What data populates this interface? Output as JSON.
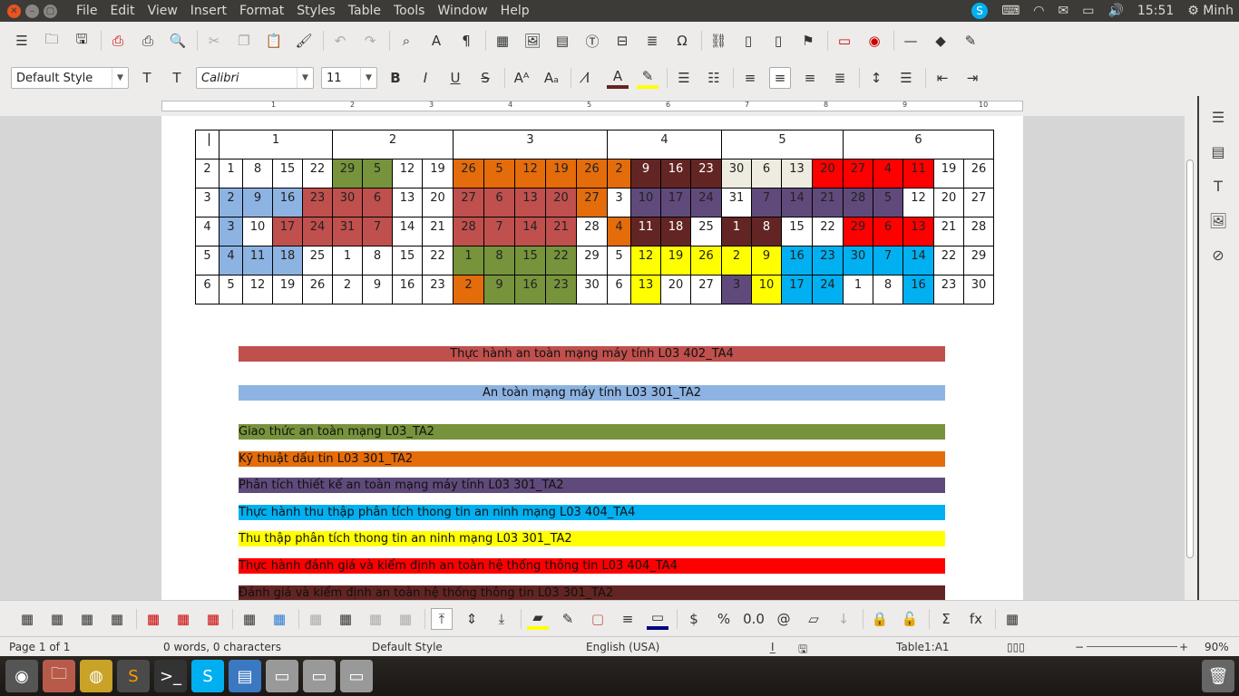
{
  "menubar": {
    "items": [
      "File",
      "Edit",
      "View",
      "Insert",
      "Format",
      "Styles",
      "Table",
      "Tools",
      "Window",
      "Help"
    ],
    "time": "15:51",
    "user": "Minh"
  },
  "format": {
    "paragraph_style": "Default Style",
    "font_name": "Calibri",
    "font_size": "11"
  },
  "ruler": {
    "marks": [
      "1",
      "2",
      "3",
      "4",
      "5",
      "6",
      "7",
      "8",
      "9",
      "10"
    ]
  },
  "calendar": {
    "header": [
      "1",
      "2",
      "3",
      "4",
      "5",
      "6"
    ],
    "rows": [
      [
        [
          "2",
          ""
        ],
        [
          "1",
          ""
        ],
        [
          "8",
          ""
        ],
        [
          "15",
          ""
        ],
        [
          "22",
          ""
        ],
        [
          "29",
          "#77933c"
        ],
        [
          "5",
          "#77933c"
        ],
        [
          "12",
          ""
        ],
        [
          "19",
          ""
        ],
        [
          "26",
          "#e46c0a"
        ],
        [
          "5",
          "#e46c0a"
        ],
        [
          "12",
          "#e46c0a"
        ],
        [
          "19",
          "#e46c0a"
        ],
        [
          "26",
          "#e46c0a"
        ],
        [
          "2",
          "#e46c0a"
        ],
        [
          "9",
          "#632523"
        ],
        [
          "16",
          "#632523"
        ],
        [
          "23",
          "#632523"
        ],
        [
          "30",
          "#eeece1"
        ],
        [
          "6",
          "#eeece1"
        ],
        [
          "13",
          "#eeece1"
        ],
        [
          "20",
          "#ff0000"
        ],
        [
          "27",
          "#ff0000"
        ],
        [
          "4",
          "#ff0000"
        ],
        [
          "11",
          "#ff0000"
        ],
        [
          "19",
          ""
        ],
        [
          "26",
          ""
        ]
      ],
      [
        [
          "3",
          ""
        ],
        [
          "2",
          "#8db3e2"
        ],
        [
          "9",
          "#8db3e2"
        ],
        [
          "16",
          "#8db3e2"
        ],
        [
          "23",
          "#c0504d"
        ],
        [
          "30",
          "#c0504d"
        ],
        [
          "6",
          "#c0504d"
        ],
        [
          "13",
          ""
        ],
        [
          "20",
          ""
        ],
        [
          "27",
          "#c0504d"
        ],
        [
          "6",
          "#c0504d"
        ],
        [
          "13",
          "#c0504d"
        ],
        [
          "20",
          "#c0504d"
        ],
        [
          "27",
          "#e46c0a"
        ],
        [
          "3",
          ""
        ],
        [
          "10",
          "#604a7b"
        ],
        [
          "17",
          "#604a7b"
        ],
        [
          "24",
          "#604a7b"
        ],
        [
          "31",
          ""
        ],
        [
          "7",
          "#604a7b"
        ],
        [
          "14",
          "#604a7b"
        ],
        [
          "21",
          "#604a7b"
        ],
        [
          "28",
          "#604a7b"
        ],
        [
          "5",
          "#604a7b"
        ],
        [
          "12",
          ""
        ],
        [
          "20",
          ""
        ],
        [
          "27",
          ""
        ]
      ],
      [
        [
          "4",
          ""
        ],
        [
          "3",
          "#8db3e2"
        ],
        [
          "10",
          ""
        ],
        [
          "17",
          "#c0504d"
        ],
        [
          "24",
          "#c0504d"
        ],
        [
          "31",
          "#c0504d"
        ],
        [
          "7",
          "#c0504d"
        ],
        [
          "14",
          ""
        ],
        [
          "21",
          ""
        ],
        [
          "28",
          "#c0504d"
        ],
        [
          "7",
          "#c0504d"
        ],
        [
          "14",
          "#c0504d"
        ],
        [
          "21",
          "#c0504d"
        ],
        [
          "28",
          ""
        ],
        [
          "4",
          "#e46c0a"
        ],
        [
          "11",
          "#632523"
        ],
        [
          "18",
          "#632523"
        ],
        [
          "25",
          ""
        ],
        [
          "1",
          "#632523"
        ],
        [
          "8",
          "#632523"
        ],
        [
          "15",
          ""
        ],
        [
          "22",
          ""
        ],
        [
          "29",
          "#ff0000"
        ],
        [
          "6",
          "#ff0000"
        ],
        [
          "13",
          "#ff0000"
        ],
        [
          "21",
          ""
        ],
        [
          "28",
          ""
        ]
      ],
      [
        [
          "5",
          ""
        ],
        [
          "4",
          "#8db3e2"
        ],
        [
          "11",
          "#8db3e2"
        ],
        [
          "18",
          "#8db3e2"
        ],
        [
          "25",
          ""
        ],
        [
          "1",
          ""
        ],
        [
          "8",
          ""
        ],
        [
          "15",
          ""
        ],
        [
          "22",
          ""
        ],
        [
          "1",
          "#77933c"
        ],
        [
          "8",
          "#77933c"
        ],
        [
          "15",
          "#77933c"
        ],
        [
          "22",
          "#77933c"
        ],
        [
          "29",
          ""
        ],
        [
          "5",
          ""
        ],
        [
          "12",
          "#ffff00"
        ],
        [
          "19",
          "#ffff00"
        ],
        [
          "26",
          "#ffff00"
        ],
        [
          "2",
          "#ffff00"
        ],
        [
          "9",
          "#ffff00"
        ],
        [
          "16",
          "#00b0f0"
        ],
        [
          "23",
          "#00b0f0"
        ],
        [
          "30",
          "#00b0f0"
        ],
        [
          "7",
          "#00b0f0"
        ],
        [
          "14",
          "#00b0f0"
        ],
        [
          "22",
          ""
        ],
        [
          "29",
          ""
        ]
      ],
      [
        [
          "6",
          ""
        ],
        [
          "5",
          ""
        ],
        [
          "12",
          ""
        ],
        [
          "19",
          ""
        ],
        [
          "26",
          ""
        ],
        [
          "2",
          ""
        ],
        [
          "9",
          ""
        ],
        [
          "16",
          ""
        ],
        [
          "23",
          ""
        ],
        [
          "2",
          "#e46c0a"
        ],
        [
          "9",
          "#77933c"
        ],
        [
          "16",
          "#77933c"
        ],
        [
          "23",
          "#77933c"
        ],
        [
          "30",
          ""
        ],
        [
          "6",
          ""
        ],
        [
          "13",
          "#ffff00"
        ],
        [
          "20",
          ""
        ],
        [
          "27",
          ""
        ],
        [
          "3",
          "#604a7b"
        ],
        [
          "10",
          "#ffff00"
        ],
        [
          "17",
          "#00b0f0"
        ],
        [
          "24",
          "#00b0f0"
        ],
        [
          "1",
          ""
        ],
        [
          "8",
          ""
        ],
        [
          "16",
          "#00b0f0"
        ],
        [
          "23",
          ""
        ],
        [
          "30",
          ""
        ]
      ]
    ]
  },
  "legend": [
    {
      "text": "Thực hành an toàn mạng máy tính L03 402_TA4",
      "color": "#c0504d",
      "align": "center"
    },
    {
      "text": "An toàn mạng máy tính L03 301_TA2",
      "color": "#8db3e2",
      "align": "center"
    },
    {
      "text": "Giao thức an toàn mạng L03_TA2",
      "color": "#77933c",
      "align": "left"
    },
    {
      "text": "Kỹ thuật dấu tin L03 301_TA2",
      "color": "#e46c0a",
      "align": "left"
    },
    {
      "text": "Phân tích thiết kế an toàn mạng máy tính L03 301_TA2",
      "color": "#604a7b",
      "align": "left"
    },
    {
      "text": "Thực hành thu thập phân tích thong tin an ninh mạng L03 404_TA4",
      "color": "#00b0f0",
      "align": "left"
    },
    {
      "text": "Thu thập phân tích thong tin an ninh mạng L03 301_TA2",
      "color": "#ffff00",
      "align": "left"
    },
    {
      "text": "Thực hành đánh giá và kiểm định an toàn hệ thống thông tin L03 404_TA4",
      "color": "#ff0000",
      "align": "left"
    },
    {
      "text": "Đánh giá và kiểm định an toàn hệ thống thông tin L03 301_TA2",
      "color": "#632523",
      "align": "left"
    }
  ],
  "status": {
    "page": "Page 1 of 1",
    "words": "0 words, 0 characters",
    "style": "Default Style",
    "language": "English (USA)",
    "cell": "Table1:A1",
    "zoom": "90%"
  },
  "colors": {
    "menubar": "#3c3b37",
    "chrome": "#edeceb",
    "launcher": "#2a2622"
  }
}
